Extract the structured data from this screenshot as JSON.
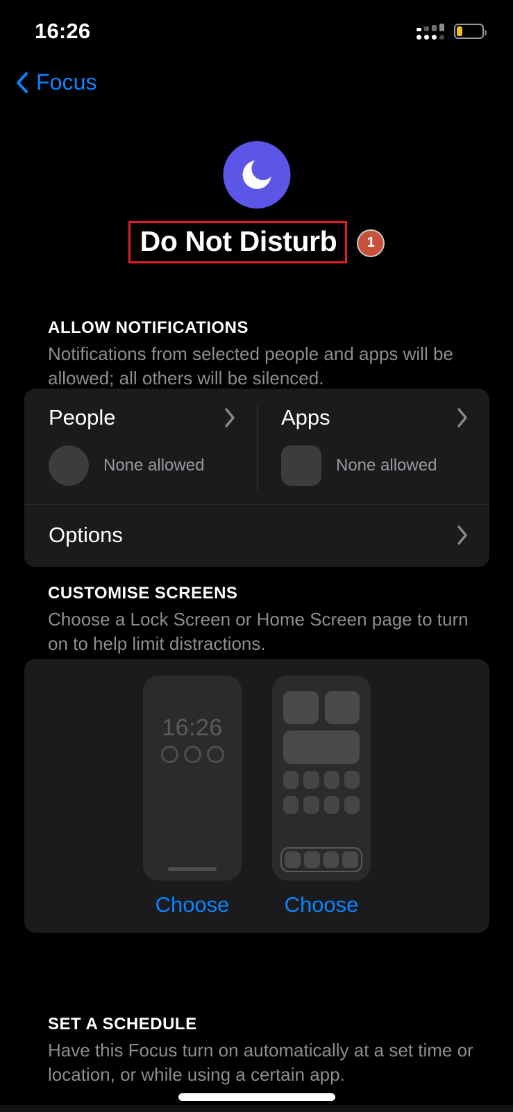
{
  "status_bar": {
    "time": "16:26",
    "signal_icon": "signal-bars-icon",
    "battery_icon": "battery-low-icon",
    "battery_level_percent": 20,
    "battery_color": "#f2c01e"
  },
  "nav": {
    "back_label": "Focus",
    "back_icon": "chevron-left-icon",
    "accent_color": "#0a84ff"
  },
  "focus": {
    "icon": "moon-icon",
    "icon_bg_color": "#5c56e8",
    "title": "Do Not Disturb",
    "badge_count": "1",
    "badge_color": "#c8513c",
    "highlight_color": "#e81c24"
  },
  "allow_notifications": {
    "heading": "ALLOW NOTIFICATIONS",
    "description": "Notifications from selected people and apps will be allowed; all others will be silenced.",
    "people": {
      "label": "People",
      "status": "None allowed",
      "chevron_icon": "chevron-right-icon",
      "placeholder_icon": "person-circle-placeholder"
    },
    "apps": {
      "label": "Apps",
      "status": "None allowed",
      "chevron_icon": "chevron-right-icon",
      "placeholder_icon": "app-square-placeholder"
    },
    "options": {
      "label": "Options",
      "chevron_icon": "chevron-right-icon"
    }
  },
  "customise_screens": {
    "heading": "CUSTOMISE SCREENS",
    "description": "Choose a Lock Screen or Home Screen page to turn on to help limit distractions.",
    "lock_screen": {
      "preview_time": "16:26",
      "choose_label": "Choose"
    },
    "home_screen": {
      "choose_label": "Choose"
    }
  },
  "set_a_schedule": {
    "heading": "SET A SCHEDULE",
    "description": "Have this Focus turn on automatically at a set time or location, or while using a certain app."
  }
}
